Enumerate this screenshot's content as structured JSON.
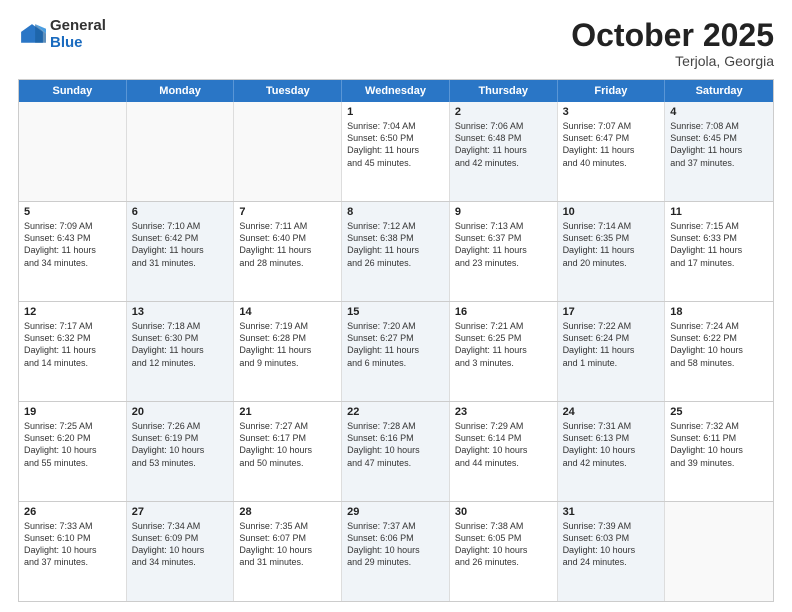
{
  "header": {
    "logo_general": "General",
    "logo_blue": "Blue",
    "title": "October 2025",
    "subtitle": "Terjola, Georgia"
  },
  "days_of_week": [
    "Sunday",
    "Monday",
    "Tuesday",
    "Wednesday",
    "Thursday",
    "Friday",
    "Saturday"
  ],
  "rows": [
    [
      {
        "day": "",
        "info": "",
        "shaded": false,
        "empty": true
      },
      {
        "day": "",
        "info": "",
        "shaded": false,
        "empty": true
      },
      {
        "day": "",
        "info": "",
        "shaded": false,
        "empty": true
      },
      {
        "day": "1",
        "info": "Sunrise: 7:04 AM\nSunset: 6:50 PM\nDaylight: 11 hours\nand 45 minutes.",
        "shaded": false,
        "empty": false
      },
      {
        "day": "2",
        "info": "Sunrise: 7:06 AM\nSunset: 6:48 PM\nDaylight: 11 hours\nand 42 minutes.",
        "shaded": true,
        "empty": false
      },
      {
        "day": "3",
        "info": "Sunrise: 7:07 AM\nSunset: 6:47 PM\nDaylight: 11 hours\nand 40 minutes.",
        "shaded": false,
        "empty": false
      },
      {
        "day": "4",
        "info": "Sunrise: 7:08 AM\nSunset: 6:45 PM\nDaylight: 11 hours\nand 37 minutes.",
        "shaded": true,
        "empty": false
      }
    ],
    [
      {
        "day": "5",
        "info": "Sunrise: 7:09 AM\nSunset: 6:43 PM\nDaylight: 11 hours\nand 34 minutes.",
        "shaded": false,
        "empty": false
      },
      {
        "day": "6",
        "info": "Sunrise: 7:10 AM\nSunset: 6:42 PM\nDaylight: 11 hours\nand 31 minutes.",
        "shaded": true,
        "empty": false
      },
      {
        "day": "7",
        "info": "Sunrise: 7:11 AM\nSunset: 6:40 PM\nDaylight: 11 hours\nand 28 minutes.",
        "shaded": false,
        "empty": false
      },
      {
        "day": "8",
        "info": "Sunrise: 7:12 AM\nSunset: 6:38 PM\nDaylight: 11 hours\nand 26 minutes.",
        "shaded": true,
        "empty": false
      },
      {
        "day": "9",
        "info": "Sunrise: 7:13 AM\nSunset: 6:37 PM\nDaylight: 11 hours\nand 23 minutes.",
        "shaded": false,
        "empty": false
      },
      {
        "day": "10",
        "info": "Sunrise: 7:14 AM\nSunset: 6:35 PM\nDaylight: 11 hours\nand 20 minutes.",
        "shaded": true,
        "empty": false
      },
      {
        "day": "11",
        "info": "Sunrise: 7:15 AM\nSunset: 6:33 PM\nDaylight: 11 hours\nand 17 minutes.",
        "shaded": false,
        "empty": false
      }
    ],
    [
      {
        "day": "12",
        "info": "Sunrise: 7:17 AM\nSunset: 6:32 PM\nDaylight: 11 hours\nand 14 minutes.",
        "shaded": false,
        "empty": false
      },
      {
        "day": "13",
        "info": "Sunrise: 7:18 AM\nSunset: 6:30 PM\nDaylight: 11 hours\nand 12 minutes.",
        "shaded": true,
        "empty": false
      },
      {
        "day": "14",
        "info": "Sunrise: 7:19 AM\nSunset: 6:28 PM\nDaylight: 11 hours\nand 9 minutes.",
        "shaded": false,
        "empty": false
      },
      {
        "day": "15",
        "info": "Sunrise: 7:20 AM\nSunset: 6:27 PM\nDaylight: 11 hours\nand 6 minutes.",
        "shaded": true,
        "empty": false
      },
      {
        "day": "16",
        "info": "Sunrise: 7:21 AM\nSunset: 6:25 PM\nDaylight: 11 hours\nand 3 minutes.",
        "shaded": false,
        "empty": false
      },
      {
        "day": "17",
        "info": "Sunrise: 7:22 AM\nSunset: 6:24 PM\nDaylight: 11 hours\nand 1 minute.",
        "shaded": true,
        "empty": false
      },
      {
        "day": "18",
        "info": "Sunrise: 7:24 AM\nSunset: 6:22 PM\nDaylight: 10 hours\nand 58 minutes.",
        "shaded": false,
        "empty": false
      }
    ],
    [
      {
        "day": "19",
        "info": "Sunrise: 7:25 AM\nSunset: 6:20 PM\nDaylight: 10 hours\nand 55 minutes.",
        "shaded": false,
        "empty": false
      },
      {
        "day": "20",
        "info": "Sunrise: 7:26 AM\nSunset: 6:19 PM\nDaylight: 10 hours\nand 53 minutes.",
        "shaded": true,
        "empty": false
      },
      {
        "day": "21",
        "info": "Sunrise: 7:27 AM\nSunset: 6:17 PM\nDaylight: 10 hours\nand 50 minutes.",
        "shaded": false,
        "empty": false
      },
      {
        "day": "22",
        "info": "Sunrise: 7:28 AM\nSunset: 6:16 PM\nDaylight: 10 hours\nand 47 minutes.",
        "shaded": true,
        "empty": false
      },
      {
        "day": "23",
        "info": "Sunrise: 7:29 AM\nSunset: 6:14 PM\nDaylight: 10 hours\nand 44 minutes.",
        "shaded": false,
        "empty": false
      },
      {
        "day": "24",
        "info": "Sunrise: 7:31 AM\nSunset: 6:13 PM\nDaylight: 10 hours\nand 42 minutes.",
        "shaded": true,
        "empty": false
      },
      {
        "day": "25",
        "info": "Sunrise: 7:32 AM\nSunset: 6:11 PM\nDaylight: 10 hours\nand 39 minutes.",
        "shaded": false,
        "empty": false
      }
    ],
    [
      {
        "day": "26",
        "info": "Sunrise: 7:33 AM\nSunset: 6:10 PM\nDaylight: 10 hours\nand 37 minutes.",
        "shaded": false,
        "empty": false
      },
      {
        "day": "27",
        "info": "Sunrise: 7:34 AM\nSunset: 6:09 PM\nDaylight: 10 hours\nand 34 minutes.",
        "shaded": true,
        "empty": false
      },
      {
        "day": "28",
        "info": "Sunrise: 7:35 AM\nSunset: 6:07 PM\nDaylight: 10 hours\nand 31 minutes.",
        "shaded": false,
        "empty": false
      },
      {
        "day": "29",
        "info": "Sunrise: 7:37 AM\nSunset: 6:06 PM\nDaylight: 10 hours\nand 29 minutes.",
        "shaded": true,
        "empty": false
      },
      {
        "day": "30",
        "info": "Sunrise: 7:38 AM\nSunset: 6:05 PM\nDaylight: 10 hours\nand 26 minutes.",
        "shaded": false,
        "empty": false
      },
      {
        "day": "31",
        "info": "Sunrise: 7:39 AM\nSunset: 6:03 PM\nDaylight: 10 hours\nand 24 minutes.",
        "shaded": true,
        "empty": false
      },
      {
        "day": "",
        "info": "",
        "shaded": false,
        "empty": true
      }
    ]
  ]
}
